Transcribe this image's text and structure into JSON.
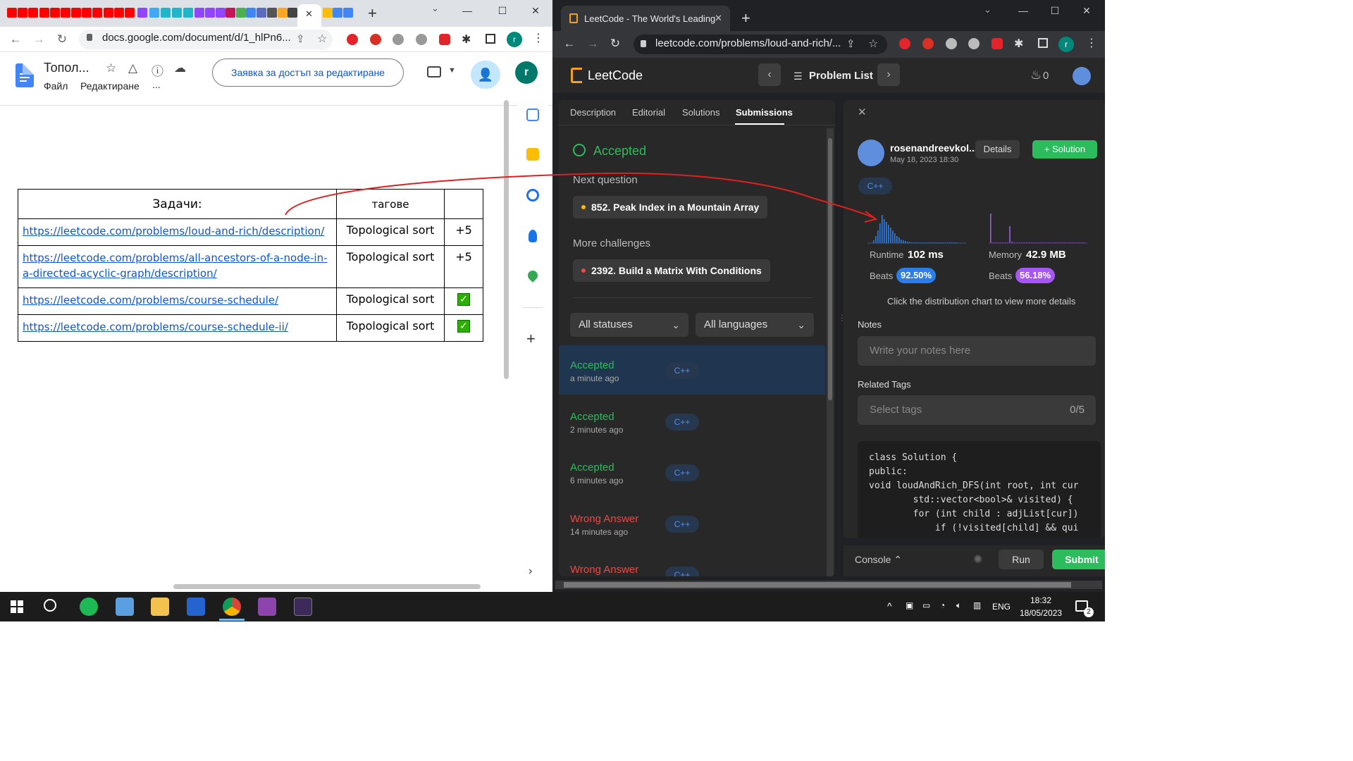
{
  "left_browser": {
    "url": "docs.google.com/document/d/1_hlPn6...",
    "tab_close": "✕",
    "new_tab": "+"
  },
  "docs": {
    "title": "Топол...",
    "menu_file": "Файл",
    "menu_edit": "Редактиране",
    "menu_more": "...",
    "request_access_label": "Заявка за достъп за редактиране",
    "avatar_letter": "r",
    "table": {
      "headers": [
        "Задачи:",
        "тагове",
        ""
      ],
      "rows": [
        {
          "link": "https://leetcode.com/problems/loud-and-rich/description/",
          "tag": "Topological sort",
          "mark": "+5"
        },
        {
          "link": "https://leetcode.com/problems/all-ancestors-of-a-node-in-a-directed-acyclic-graph/description/",
          "tag": "Topological sort",
          "mark": "+5"
        },
        {
          "link": "https://leetcode.com/problems/course-schedule/",
          "tag": "Topological sort",
          "mark": "✓"
        },
        {
          "link": "https://leetcode.com/problems/course-schedule-ii/",
          "tag": "Topological sort",
          "mark": "✓"
        }
      ]
    }
  },
  "right_browser": {
    "tab_title": "LeetCode - The World's Leading",
    "url": "leetcode.com/problems/loud-and-rich/...",
    "avatar_letter": "r"
  },
  "leetcode": {
    "logo": "LeetCode",
    "problem_list": "Problem List",
    "streak": "0",
    "tabs": [
      "Description",
      "Editorial",
      "Solutions",
      "Submissions"
    ],
    "result_title": "Accepted",
    "next_question_label": "Next question",
    "next_question": "852. Peak Index in a Mountain Array",
    "more_challenges_label": "More challenges",
    "more_challenge": "2392. Build a Matrix With Conditions",
    "filter_status": "All statuses",
    "filter_language": "All languages",
    "submissions": [
      {
        "status": "Accepted",
        "time": "a minute ago",
        "lang": "C++"
      },
      {
        "status": "Accepted",
        "time": "2 minutes ago",
        "lang": "C++"
      },
      {
        "status": "Accepted",
        "time": "6 minutes ago",
        "lang": "C++"
      },
      {
        "status": "Wrong Answer",
        "time": "14 minutes ago",
        "lang": "C++"
      },
      {
        "status": "Wrong Answer",
        "time": "",
        "lang": "C++"
      }
    ],
    "detail": {
      "username": "rosenandreevkol...",
      "date": "May 18, 2023 18:30",
      "details_btn": "Details",
      "solution_btn": "Solution",
      "lang": "C++",
      "runtime_label": "Runtime",
      "runtime_value": "102 ms",
      "memory_label": "Memory",
      "memory_value": "42.9 MB",
      "beats_label": "Beats",
      "runtime_beats": "92.50%",
      "memory_beats": "56.18%",
      "hint": "Click the distribution chart to view more details",
      "notes_label": "Notes",
      "notes_placeholder": "Write your notes here",
      "tags_label": "Related Tags",
      "tags_placeholder": "Select tags",
      "tags_count": "0/5",
      "code": [
        "class Solution {",
        "public:",
        "void loudAndRich_DFS(int root, int cur",
        "        std::vector<bool>& visited) {",
        "        for (int child : adjList[cur])",
        "            if (!visited[child] && qui"
      ]
    },
    "console_label": "Console",
    "run_label": "Run",
    "submit_label": "Submit"
  },
  "taskbar": {
    "lang": "ENG",
    "time": "18:32",
    "date": "18/05/2023",
    "notifications": "2"
  },
  "colors": {
    "accepted": "#2cbb5d",
    "wrong": "#ef4743",
    "runtime_accent": "#2b7de9",
    "memory_accent": "#a855f7",
    "annotation_arrow": "#e0201e"
  }
}
